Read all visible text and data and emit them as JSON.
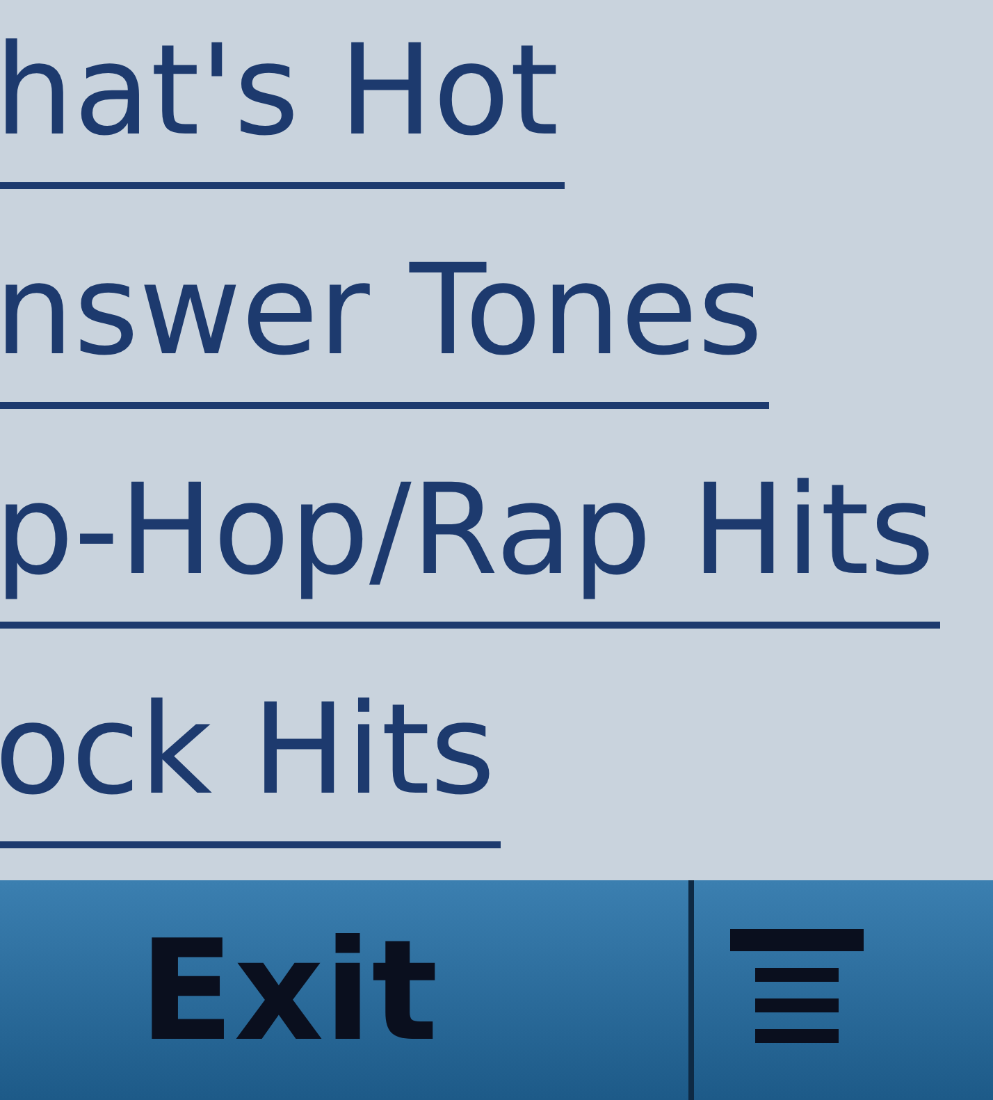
{
  "menu": {
    "items": [
      {
        "label": "hat's Hot"
      },
      {
        "label": "nswer Tones"
      },
      {
        "label": "p-Hop/Rap Hits"
      },
      {
        "label": "ock Hits"
      }
    ]
  },
  "softkeys": {
    "left": "Exit"
  }
}
